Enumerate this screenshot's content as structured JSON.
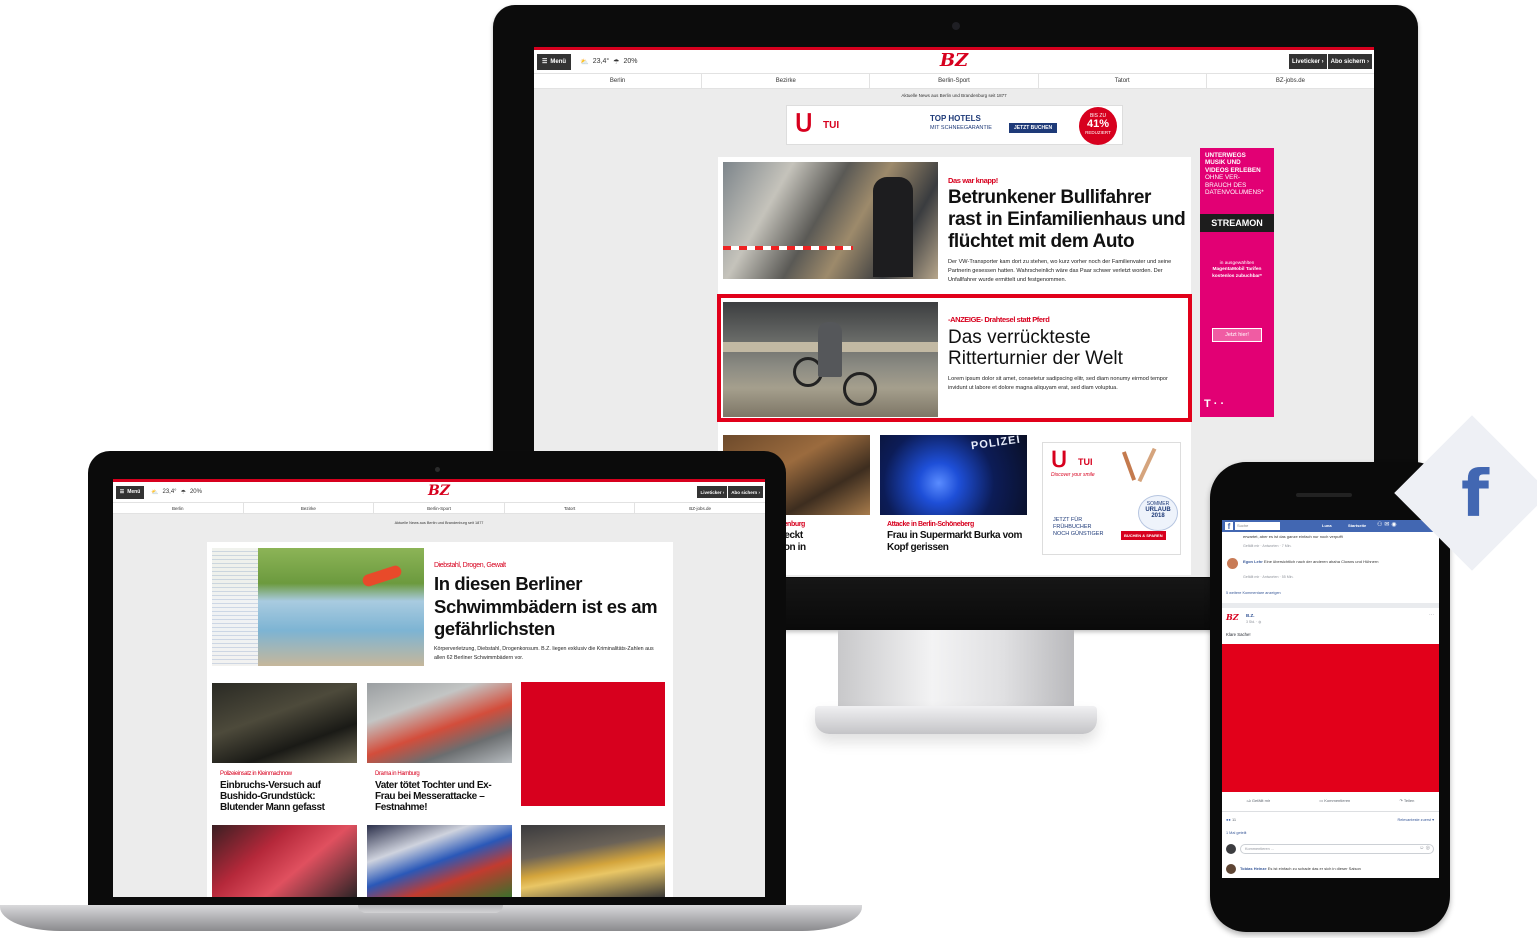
{
  "colors": {
    "brand_red": "#d7001e",
    "facebook_blue": "#4267b2"
  },
  "site": {
    "menu_label": "Menü",
    "weather": "23,4°",
    "rain": "20%",
    "logo": "BZ",
    "liveticker": "Liveticker ›",
    "abo": "Abo sichern ›",
    "nav": [
      "Berlin",
      "Bezirke",
      "Berlin-Sport",
      "Tatort",
      "BZ-jobs.de"
    ],
    "tagline": "Aktuelle News aus Berlin und Brandenburg seit 1877"
  },
  "desktop": {
    "ad_top": {
      "brand": "TUI",
      "line1": "TOP HOTELS",
      "line2": "MIT SCHNEEGARANTIE",
      "cta": "JETZT BUCHEN",
      "badge_top": "BIS ZU",
      "badge_pct": "41%",
      "badge_bottom": "REDUZIERT"
    },
    "lead": {
      "kicker": "Das war knapp!",
      "headline": "Betrunkener Bullifahrer rast in Einfamilienhaus und flüchtet mit dem Auto",
      "teaser": "Der VW-Transporter kam dort zu stehen, wo kurz vorher noch der Familienvater und seine Partnerin gesessen hatten. Wahrscheinlich wäre das Paar schwer verletzt worden. Der Unfallfahrer wurde ermittelt und festgenommen."
    },
    "native": {
      "kicker": "-ANZEIGE- Drahtesel statt Pferd",
      "headline": "Das verrückteste Ritterturnier der Welt",
      "teaser": "Lorem ipsum dolor sit amet, consetetur sadipscing elitr, sed diam nonumy eirmod tempor invidunt ut labore et dolore magna aliquyam erat, sed diam voluptua."
    },
    "teaser_left": {
      "kicker": "randenburg",
      "headline": "ntdeckt\nerson in"
    },
    "teaser_mid": {
      "kicker": "Attacke in Berlin-Schöneberg",
      "headline": "Frau in Supermarkt Burka vom Kopf gerissen",
      "image_text": "POLIZEI"
    },
    "ad_side": {
      "brand": "TUI",
      "script": "Discover your smile",
      "sommer": "SOMMER",
      "urlaub": "URLAUB",
      "year": "2018",
      "line1": "JETZT FÜR",
      "line2": "FRÜHBUCHER",
      "line3": "NOCH GÜNSTIGER",
      "cta": "BUCHEN & SPAREN"
    },
    "skyscraper": {
      "line1": "UNTERWEGS",
      "line2": "MUSIK UND",
      "line3": "VIDEOS ERLEBEN",
      "line4": "OHNE VER-",
      "line5": "BRAUCH DES",
      "line6": "DATENVOLUMENS*",
      "stream": "STREAMON",
      "small1": "in ausgewählten",
      "small2": "MagentaMobil Tarifen",
      "small3": "kostenlos zubuchbar*",
      "cta": "Jetzt hier!",
      "logo": "T · ·"
    }
  },
  "laptop": {
    "lead": {
      "kicker": "Diebstahl, Drogen, Gewalt",
      "headline": "In diesen Berliner Schwimmbädern ist es am gefährlichsten",
      "teaser": "Körperverletzung, Diebstahl, Drogenkonsum. B.Z. liegen exklusiv die Kriminalitäts-Zahlen aus allen 62 Berliner Schwimmbädern vor."
    },
    "teasers": [
      {
        "kicker": "Polizeieinsatz in Kleinmachnow",
        "headline": "Einbruchs-Versuch auf Bushido-Grundstück: Blutender Mann gefasst"
      },
      {
        "kicker": "Drama in Hamburg",
        "headline": "Vater tötet Tochter und Ex-Frau bei Messerattacke – Festnahme!"
      }
    ]
  },
  "phone": {
    "search": "Suche",
    "user": "Luna",
    "home": "Startseite",
    "comment1": "erwartet, aber es ist das ganze einfach nur noch verpufft",
    "actions1": "Gefällt mir · Antworten · 7 Min.",
    "comment2_author": "Egon Lehr",
    "comment2_text": "Eine übersichtlich nach der anderen ahaha Clowns und Hühnern",
    "actions2": "Gefällt mir · Antworten · 55 Min.",
    "more_comments": "5 weitere Kommentare anzeigen",
    "page_name": "B.Z.",
    "post_time": "3 Std. · ◍",
    "post_text": "Klare Sache!",
    "like": "Gefällt mir",
    "comment": "Kommentieren",
    "share": "Teilen",
    "reactions": "11",
    "relevance": "Relevanteste zuerst ▾",
    "shared": "1 Mal geteilt",
    "write_comment": "Kommentieren ...",
    "last_comment_author": "Tobias Heinze",
    "last_comment_text": "Es ist einfach zu schade das er sich in dieser Saison"
  },
  "facebook_badge": {
    "letter": "f"
  }
}
